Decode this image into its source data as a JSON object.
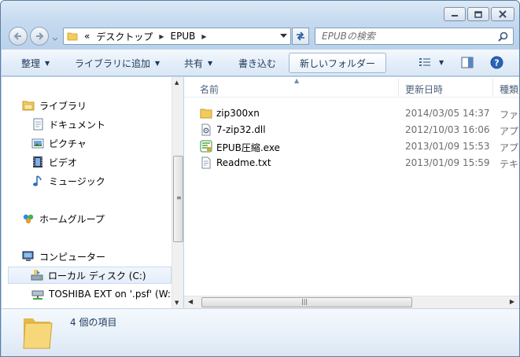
{
  "address": {
    "overflow": "«",
    "crumbs": [
      "デスクトップ",
      "EPUB"
    ]
  },
  "search": {
    "placeholder": "EPUBの検索"
  },
  "toolbar": {
    "organize": "整理",
    "add_to_library": "ライブラリに追加",
    "share": "共有",
    "burn": "書き込む",
    "new_folder": "新しいフォルダー"
  },
  "nav": {
    "libraries": "ライブラリ",
    "documents": "ドキュメント",
    "pictures": "ピクチャ",
    "videos": "ビデオ",
    "music": "ミュージック",
    "homegroup": "ホームグループ",
    "computer": "コンピューター",
    "local_disk": "ローカル ディスク (C:)",
    "network_drive": "TOSHIBA EXT on '.psf' (W:"
  },
  "columns": {
    "name": "名前",
    "date": "更新日時",
    "type": "種類"
  },
  "files": [
    {
      "name": "zip300xn",
      "date": "2014/03/05 14:37",
      "type": "ファ",
      "icon": "folder-icon"
    },
    {
      "name": "7-zip32.dll",
      "date": "2012/10/03 16:06",
      "type": "アプ",
      "icon": "dll-file-icon"
    },
    {
      "name": "EPUB圧縮.exe",
      "date": "2013/01/09 15:53",
      "type": "アプ",
      "icon": "exe-file-icon"
    },
    {
      "name": "Readme.txt",
      "date": "2013/01/09 15:59",
      "type": "テキ",
      "icon": "text-file-icon"
    }
  ],
  "status": {
    "count": "4 個の項目"
  },
  "colors": {
    "frame": "#bcd3ea",
    "toolbar_text": "#1e395b",
    "folder_yellow": "#f2cc5a",
    "selected_bg": "#e3edf9"
  }
}
